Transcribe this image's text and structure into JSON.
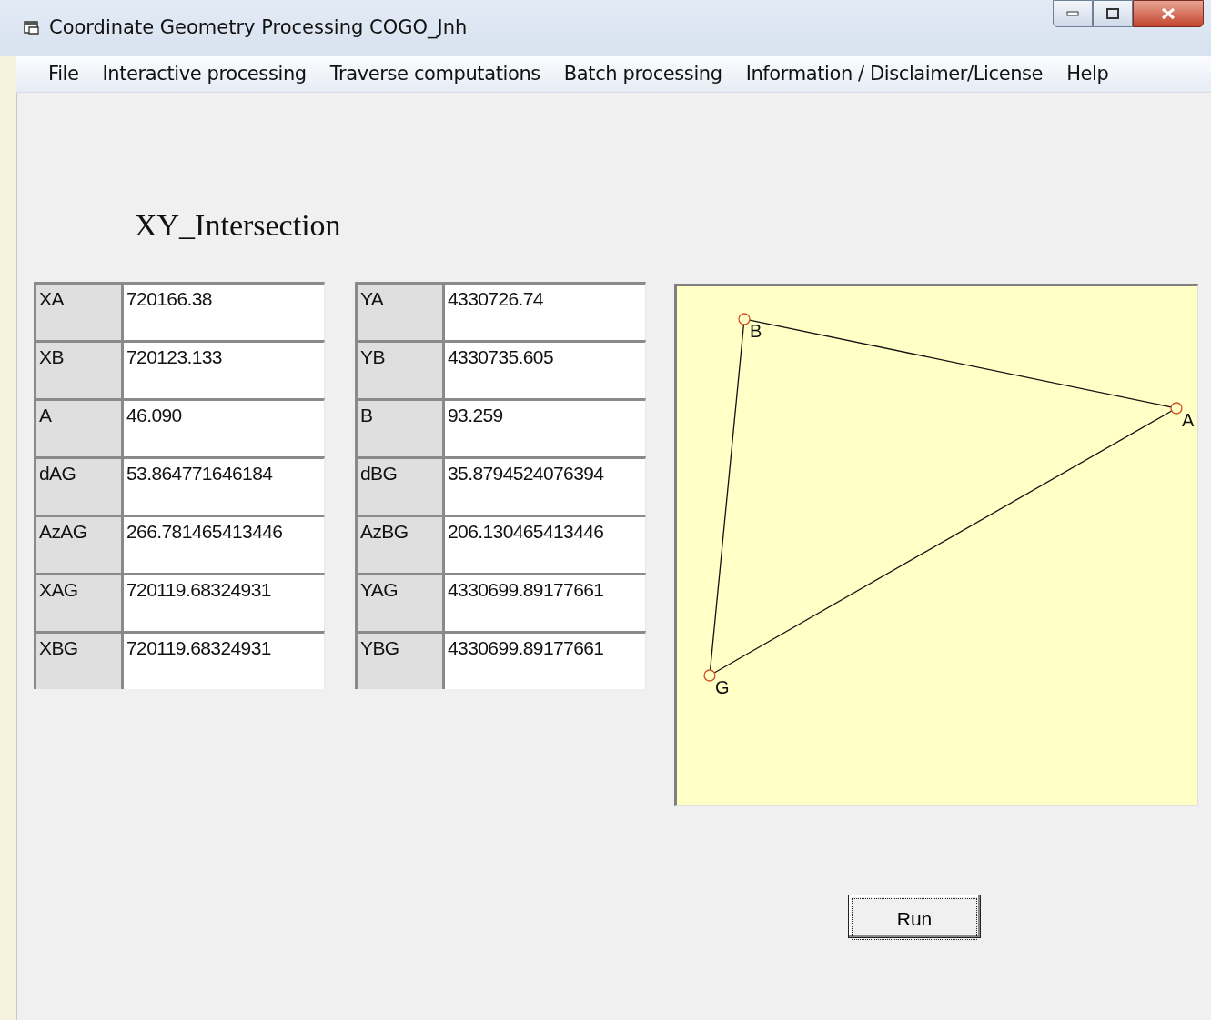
{
  "window": {
    "title": "Coordinate Geometry Processing COGO_Jnh"
  },
  "menu": [
    {
      "label": "File"
    },
    {
      "label": "Interactive processing"
    },
    {
      "label": "Traverse computations"
    },
    {
      "label": "Batch processing"
    },
    {
      "label": "Information / Disclaimer/License"
    },
    {
      "label": "Help"
    }
  ],
  "form": {
    "title": "XY_Intersection",
    "left_fields": [
      {
        "label": "XA",
        "value": "720166.38"
      },
      {
        "label": "XB",
        "value": "720123.133"
      },
      {
        "label": "A",
        "value": "46.090"
      },
      {
        "label": "dAG",
        "value": "53.864771646184"
      },
      {
        "label": "AzAG",
        "value": "266.781465413446"
      },
      {
        "label": "XAG",
        "value": "720119.68324931"
      },
      {
        "label": "XBG",
        "value": "720119.68324931"
      }
    ],
    "right_fields": [
      {
        "label": "YA",
        "value": "4330726.74"
      },
      {
        "label": "YB",
        "value": "4330735.605"
      },
      {
        "label": "B",
        "value": "93.259"
      },
      {
        "label": "dBG",
        "value": "35.8794524076394"
      },
      {
        "label": "AzBG",
        "value": "206.130465413446"
      },
      {
        "label": "YAG",
        "value": "4330699.89177661"
      },
      {
        "label": "YBG",
        "value": "4330699.89177661"
      }
    ]
  },
  "diagram": {
    "points": [
      {
        "label": "B"
      },
      {
        "label": "A"
      },
      {
        "label": "G"
      }
    ]
  },
  "buttons": [
    {
      "label": "Run",
      "focused": true
    }
  ]
}
